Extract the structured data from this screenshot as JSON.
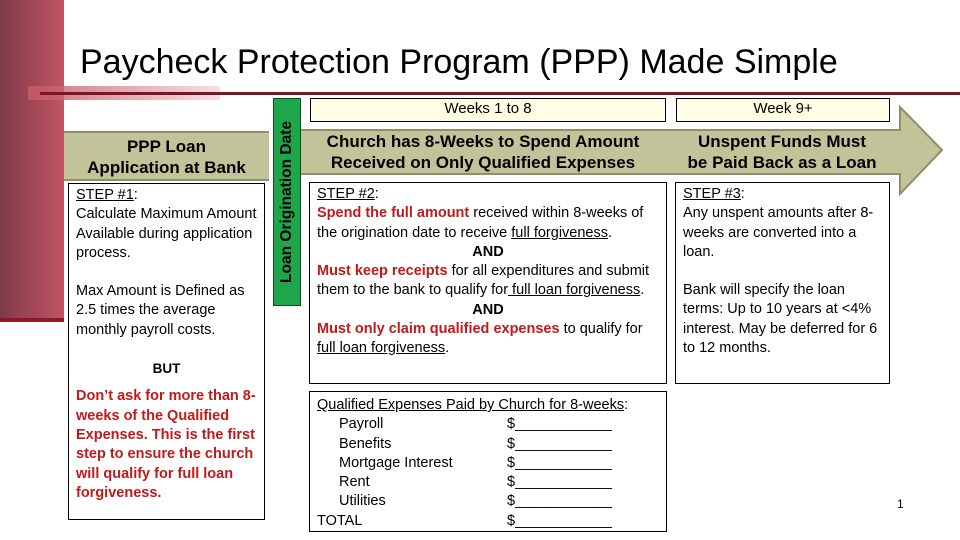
{
  "slide": {
    "title": "Paycheck Protection Program (PPP) Made Simple",
    "page_number": "1",
    "colors": {
      "accent_maroon": "#7a1426",
      "band_khaki": "#c3c39a",
      "origination_green": "#1fa64a",
      "emphasis_red": "#c01a1a",
      "week_label_bg": "#fffde3"
    }
  },
  "left_column": {
    "heading_line1": "PPP Loan",
    "heading_line2": "Application at Bank",
    "step_label": "STEP #1",
    "step_colon": ":",
    "step_text": "Calculate Maximum Amount Available during application process.",
    "max_text": "Max Amount is Defined as 2.5 times the average monthly payroll costs.",
    "but_label": "BUT",
    "warning_text": "Don’t ask for more than 8-weeks of the Qualified Expenses. This is the first step to ensure the church will qualify for full loan forgiveness."
  },
  "origination_bar": {
    "label": "Loan Origination Date"
  },
  "middle_column": {
    "week_label": "Weeks 1 to 8",
    "heading_line1": "Church has 8-Weeks to Spend Amount",
    "heading_line2": "Received on Only Qualified Expenses",
    "step_label": "STEP #2",
    "step_colon": ":",
    "item1_bold": "Spend the full amount",
    "item1_text": " received within 8-weeks of the origination date to receive ",
    "item1_link": "full forgiveness",
    "item1_end": ".",
    "and1": "AND",
    "item2_bold": "Must keep receipts",
    "item2_text": " for all expenditures and submit them to the bank to qualify for",
    "item2_link": " full loan forgiveness",
    "item2_end": ".",
    "and2": "AND",
    "item3_bold": "Must only claim qualified expenses",
    "item3_text": " to qualify for ",
    "item3_link": "full loan forgiveness",
    "item3_end": "."
  },
  "expenses": {
    "heading": "Qualified Expenses Paid by Church for 8-weeks",
    "heading_colon": ":",
    "rows": [
      {
        "name": "Payroll",
        "amount": "$____________"
      },
      {
        "name": "Benefits",
        "amount": "$____________"
      },
      {
        "name": "Mortgage Interest",
        "amount": "$____________"
      },
      {
        "name": "Rent",
        "amount": "$____________"
      },
      {
        "name": "Utilities",
        "amount": "$____________"
      }
    ],
    "total_label": "TOTAL",
    "total_amount": "$____________"
  },
  "right_column": {
    "week_label": "Week 9+",
    "heading_line1": "Unspent Funds Must",
    "heading_line2": "be Paid Back as a Loan",
    "step_label": "STEP #3",
    "step_colon": ":",
    "step_text": "Any unspent amounts after 8-weeks are converted into a loan.",
    "terms_text": "Bank will specify the loan terms:  Up to 10 years at <4% interest.  May be deferred for 6 to 12 months."
  }
}
